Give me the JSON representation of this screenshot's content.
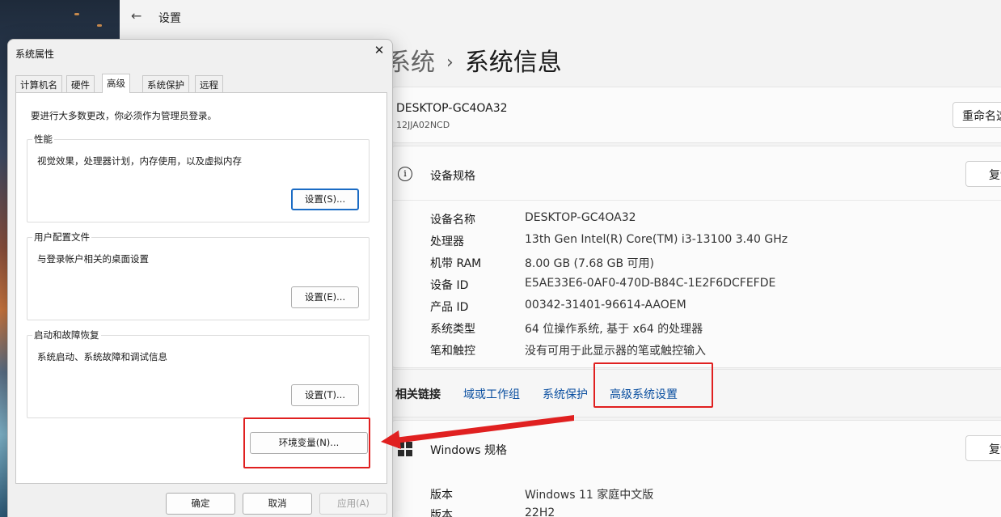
{
  "settings": {
    "window_title": "设置",
    "breadcrumb_parent": "系统",
    "breadcrumb_sep": "›",
    "page_title": "系统信息",
    "device": {
      "name": "DESKTOP-GC4OA32",
      "model": "12JJA02NCD",
      "rename_label": "重命名这"
    },
    "device_specs": {
      "title": "设备规格",
      "copy_label": "复制",
      "rows": [
        {
          "key": "设备名称",
          "value": "DESKTOP-GC4OA32"
        },
        {
          "key": "处理器",
          "value": "13th Gen Intel(R) Core(TM) i3-13100   3.40 GHz"
        },
        {
          "key": "机带 RAM",
          "value": "8.00 GB (7.68 GB 可用)"
        },
        {
          "key": "设备 ID",
          "value": "E5AE33E6-0AF0-470D-B84C-1E2F6DCFEFDE"
        },
        {
          "key": "产品 ID",
          "value": "00342-31401-96614-AAOEM"
        },
        {
          "key": "系统类型",
          "value": "64 位操作系统, 基于 x64 的处理器"
        },
        {
          "key": "笔和触控",
          "value": "没有可用于此显示器的笔或触控输入"
        }
      ]
    },
    "related_links": {
      "label": "相关链接",
      "links": [
        "域或工作组",
        "系统保护",
        "高级系统设置"
      ]
    },
    "windows_specs": {
      "title": "Windows 规格",
      "copy_label": "复制",
      "rows": [
        {
          "key": "版本",
          "value": "Windows 11 家庭中文版"
        },
        {
          "key": "版本",
          "value": "22H2"
        }
      ]
    }
  },
  "dialog": {
    "title": "系统属性",
    "close_glyph": "✕",
    "tabs": [
      "计算机名",
      "硬件",
      "高级",
      "系统保护",
      "远程"
    ],
    "active_tab": "高级",
    "admin_note": "要进行大多数更改，你必须作为管理员登录。",
    "performance": {
      "legend": "性能",
      "desc": "视觉效果，处理器计划，内存使用，以及虚拟内存",
      "button": "设置(S)..."
    },
    "user_profiles": {
      "legend": "用户配置文件",
      "desc": "与登录帐户相关的桌面设置",
      "button": "设置(E)..."
    },
    "startup_recovery": {
      "legend": "启动和故障恢复",
      "desc": "系统启动、系统故障和调试信息",
      "button": "设置(T)..."
    },
    "env_vars_button": "环境变量(N)...",
    "ok": "确定",
    "cancel": "取消",
    "apply": "应用(A)"
  },
  "icons": {
    "back": "back-arrow-icon",
    "info": "info-icon",
    "windows": "windows-logo-icon",
    "close": "close-icon"
  },
  "annotation_color": "#e02020"
}
